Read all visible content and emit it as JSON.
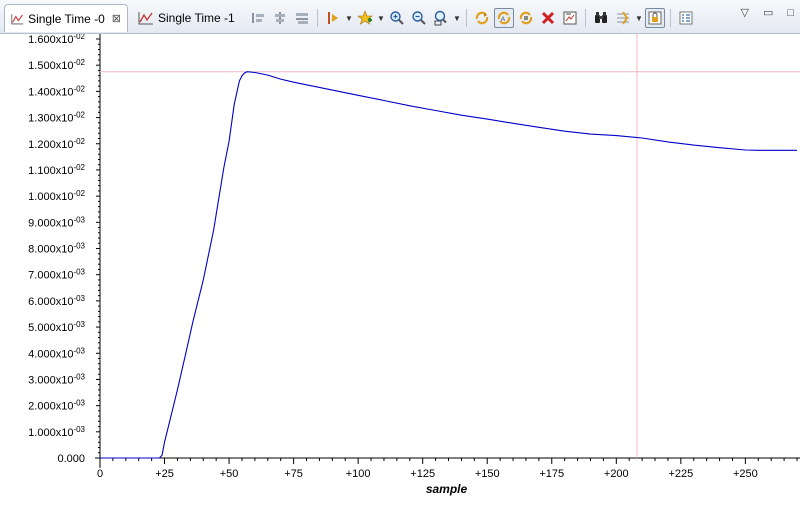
{
  "tabs": [
    {
      "label": "Single Time -0",
      "active": true
    },
    {
      "label": "Single Time -1",
      "active": false
    }
  ],
  "toolbar_icons": [
    "align-left-icon",
    "align-center-icon",
    "align-right-icon",
    "dropdown-marker-icon",
    "add-star-icon",
    "zoom-in-icon",
    "zoom-out-icon",
    "zoom-fit-icon",
    "refresh-icon",
    "auto-scale-icon",
    "sync-icon",
    "clear-icon",
    "export-icon",
    "binoculars-icon",
    "measure-icon",
    "lock-icon",
    "legend-icon"
  ],
  "chart_data": {
    "type": "line",
    "xlabel": "sample",
    "ylabel": "",
    "xlim": [
      0,
      270
    ],
    "ylim": [
      0,
      0.016
    ],
    "x_ticks": [
      "0",
      "+25",
      "+50",
      "+75",
      "+100",
      "+125",
      "+150",
      "+175",
      "+200",
      "+225",
      "+250"
    ],
    "y_ticks": [
      {
        "m": "0.000",
        "e": ""
      },
      {
        "m": "1.000x10",
        "e": "-03"
      },
      {
        "m": "2.000x10",
        "e": "-03"
      },
      {
        "m": "3.000x10",
        "e": "-03"
      },
      {
        "m": "4.000x10",
        "e": "-03"
      },
      {
        "m": "5.000x10",
        "e": "-03"
      },
      {
        "m": "6.000x10",
        "e": "-03"
      },
      {
        "m": "7.000x10",
        "e": "-03"
      },
      {
        "m": "8.000x10",
        "e": "-03"
      },
      {
        "m": "9.000x10",
        "e": "-03"
      },
      {
        "m": "1.000x10",
        "e": "-02"
      },
      {
        "m": "1.100x10",
        "e": "-02"
      },
      {
        "m": "1.200x10",
        "e": "-02"
      },
      {
        "m": "1.300x10",
        "e": "-02"
      },
      {
        "m": "1.400x10",
        "e": "-02"
      },
      {
        "m": "1.500x10",
        "e": "-02"
      },
      {
        "m": "1.600x10",
        "e": "-02"
      }
    ],
    "series": [
      {
        "color": "#0000c8",
        "x": [
          0,
          10,
          20,
          23,
          24,
          25,
          27,
          30,
          33,
          36,
          40,
          44,
          48,
          50,
          52,
          54,
          55,
          56,
          57,
          60,
          65,
          70,
          75,
          80,
          90,
          100,
          110,
          120,
          130,
          140,
          150,
          160,
          170,
          180,
          190,
          200,
          210,
          220,
          230,
          240,
          250,
          255,
          260,
          270
        ],
        "y": [
          0,
          0,
          0,
          0,
          0.0001,
          0.0006,
          0.0014,
          0.0026,
          0.0039,
          0.0052,
          0.0068,
          0.0087,
          0.0111,
          0.0121,
          0.0135,
          0.0144,
          0.0146,
          0.0147,
          0.01475,
          0.01472,
          0.01462,
          0.01447,
          0.01435,
          0.01425,
          0.01405,
          0.01385,
          0.01365,
          0.01345,
          0.01327,
          0.01309,
          0.01294,
          0.01278,
          0.01263,
          0.01248,
          0.01237,
          0.01231,
          0.01222,
          0.01207,
          0.01195,
          0.01185,
          0.01176,
          0.01175,
          0.01175,
          0.01175
        ]
      }
    ],
    "cursor": {
      "x": 208,
      "y": 0.01475,
      "color": "#f0b8c0"
    }
  }
}
